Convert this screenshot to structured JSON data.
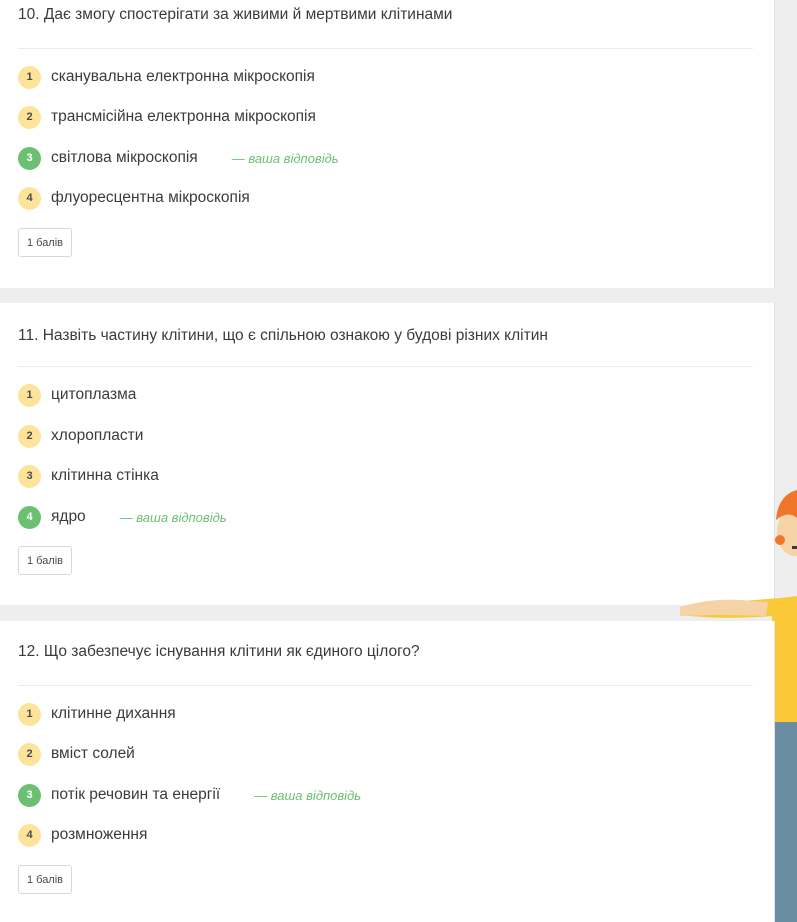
{
  "questions": [
    {
      "title": "10. Дає змогу спостерігати за живими й мертвими клітинами",
      "options": [
        {
          "num": "1",
          "text": "сканувальна електронна мікроскопія"
        },
        {
          "num": "2",
          "text": "трансмісійна електронна мікроскопія"
        },
        {
          "num": "3",
          "text": "світлова мікроскопія",
          "note": "— ваша відповідь"
        },
        {
          "num": "4",
          "text": "флуоресцентна мікроскопія"
        }
      ],
      "score": "1 балів"
    },
    {
      "title": "11. Назвіть частину клітини, що є спільною ознакою у будові різних клітин",
      "options": [
        {
          "num": "1",
          "text": "цитоплазма"
        },
        {
          "num": "2",
          "text": "хлоропласти"
        },
        {
          "num": "3",
          "text": "клітинна стінка"
        },
        {
          "num": "4",
          "text": "ядро",
          "note": "— ваша відповідь"
        }
      ],
      "score": "1 балів"
    },
    {
      "title": "12. Що забезпечує існування клітини як єдиного цілого?",
      "options": [
        {
          "num": "1",
          "text": "клітинне дихання"
        },
        {
          "num": "2",
          "text": "вміст солей"
        },
        {
          "num": "3",
          "text": "потік речовин та енергії",
          "note": "— ваша відповідь"
        },
        {
          "num": "4",
          "text": "розмноження"
        }
      ],
      "score": "1 балів"
    }
  ],
  "colors": {
    "option_badge": "#fde49a",
    "correct_badge": "#6cc071",
    "your_answer_text": "#6cc071"
  }
}
